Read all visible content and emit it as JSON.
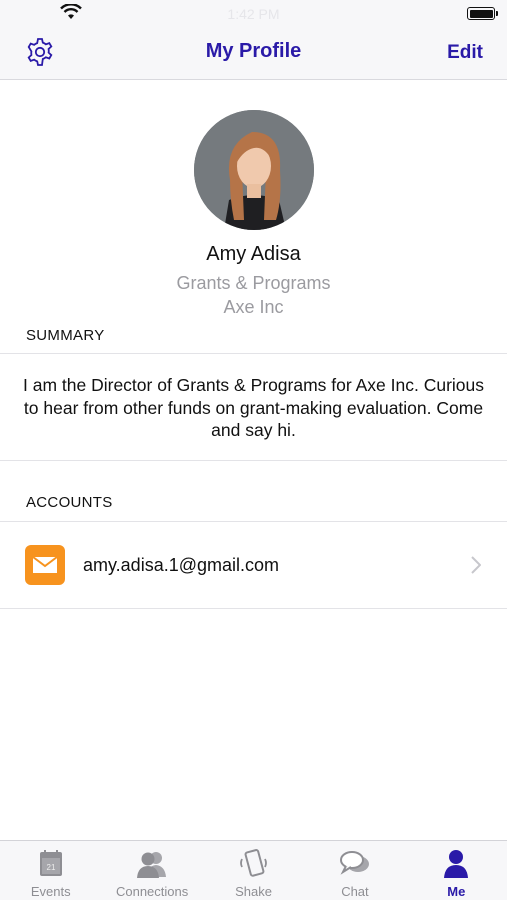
{
  "status_bar": {
    "time": "1:42 PM"
  },
  "nav": {
    "title": "My Profile",
    "edit_label": "Edit"
  },
  "profile": {
    "name": "Amy Adisa",
    "department": "Grants & Programs",
    "company": "Axe Inc"
  },
  "summary": {
    "header": "SUMMARY",
    "text": "I am the Director of Grants & Programs for Axe Inc. Curious to hear from other funds on grant-making evaluation. Come and say hi."
  },
  "accounts": {
    "header": "ACCOUNTS",
    "items": [
      {
        "type": "mail-icon",
        "email": "amy.adisa.1@gmail.com"
      }
    ]
  },
  "tabs": [
    {
      "label": "Events",
      "icon": "calendar-icon",
      "badge": "21",
      "active": false
    },
    {
      "label": "Connections",
      "icon": "people-icon",
      "active": false
    },
    {
      "label": "Shake",
      "icon": "shake-phone-icon",
      "active": false
    },
    {
      "label": "Chat",
      "icon": "chat-icon",
      "active": false
    },
    {
      "label": "Me",
      "icon": "person-icon",
      "active": true
    }
  ],
  "colors": {
    "accent": "#2a1aa8",
    "mail": "#f7931e",
    "muted": "#9b9ba0"
  }
}
